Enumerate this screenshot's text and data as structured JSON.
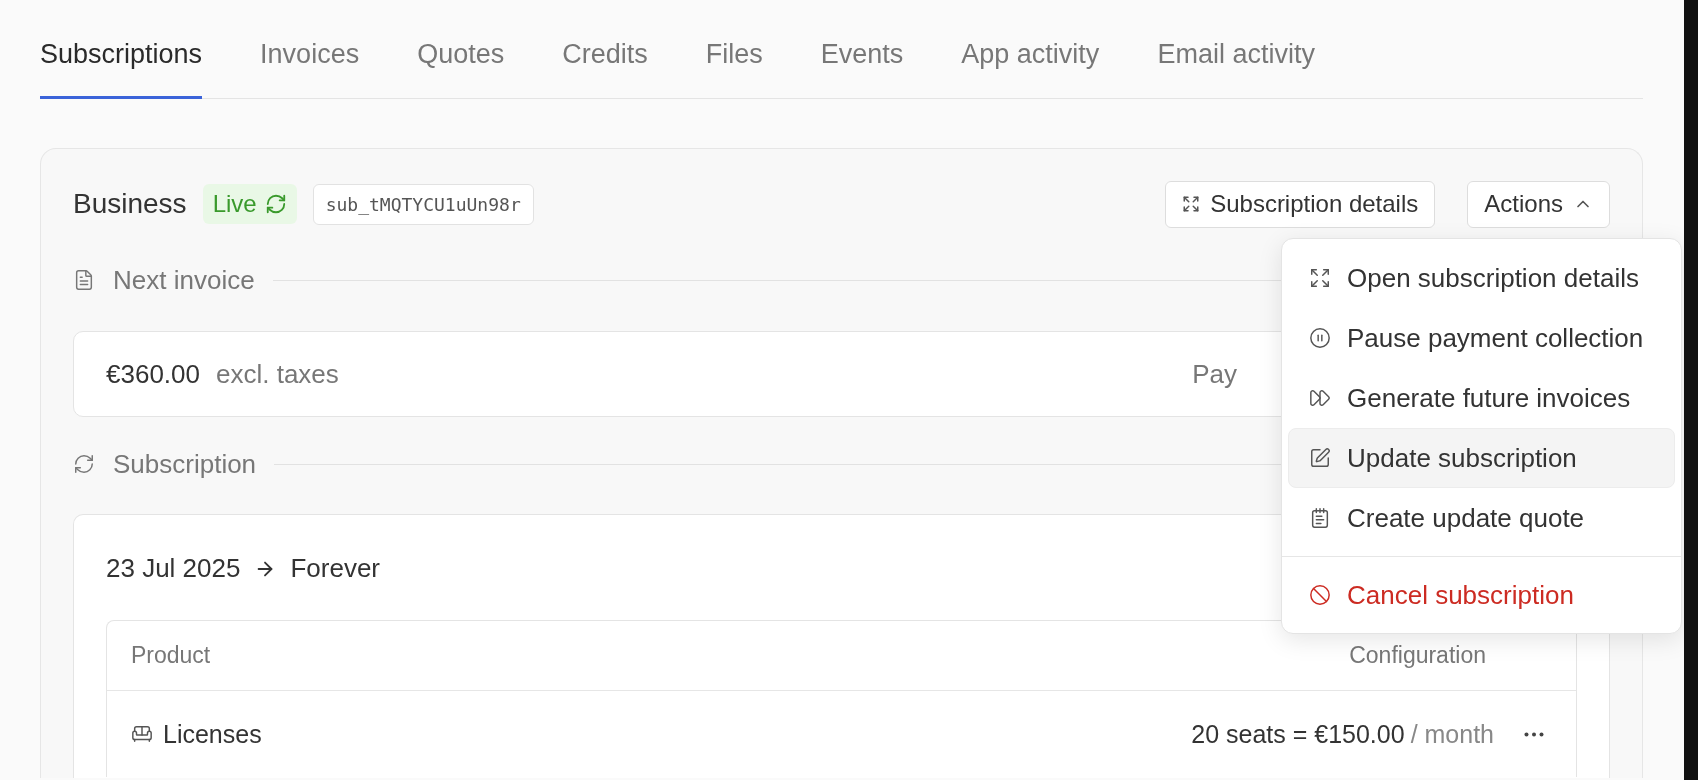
{
  "tabs": [
    {
      "label": "Subscriptions",
      "selected": true
    },
    {
      "label": "Invoices",
      "selected": false
    },
    {
      "label": "Quotes",
      "selected": false
    },
    {
      "label": "Credits",
      "selected": false
    },
    {
      "label": "Files",
      "selected": false
    },
    {
      "label": "Events",
      "selected": false
    },
    {
      "label": "App activity",
      "selected": false
    },
    {
      "label": "Email activity",
      "selected": false
    }
  ],
  "subscription": {
    "plan": "Business",
    "status": "Live",
    "id": "sub_tMQTYCU1uUn98r",
    "buttons": [
      {
        "kind": "details",
        "label": "Subscription details"
      },
      {
        "kind": "actions",
        "label": "Actions",
        "expanded": true
      }
    ],
    "next_invoice": {
      "heading": "Next invoice",
      "amount": "€360.00",
      "note": "excl. taxes",
      "column_2": "Pay"
    },
    "section": {
      "heading": "Subscription",
      "start": "23 Jul 2025",
      "end": "Forever",
      "table": {
        "columns": [
          "Product",
          "Configuration"
        ],
        "rows": [
          {
            "product": "Licenses",
            "quantity": "20 seats = €150.00",
            "period": "/ month"
          }
        ]
      }
    }
  },
  "menu": {
    "items": [
      {
        "kind": "expand",
        "label": "Open subscription details",
        "highlighted": false,
        "danger": false
      },
      {
        "kind": "pause",
        "label": "Pause payment collection",
        "highlighted": false,
        "danger": false
      },
      {
        "kind": "forward",
        "label": "Generate future invoices",
        "highlighted": false,
        "danger": false
      },
      {
        "kind": "edit",
        "label": "Update subscription",
        "highlighted": true,
        "danger": false
      },
      {
        "kind": "quote",
        "label": "Create update quote",
        "highlighted": false,
        "danger": false
      },
      {
        "kind": "cancel",
        "label": "Cancel subscription",
        "highlighted": false,
        "danger": true
      }
    ]
  }
}
